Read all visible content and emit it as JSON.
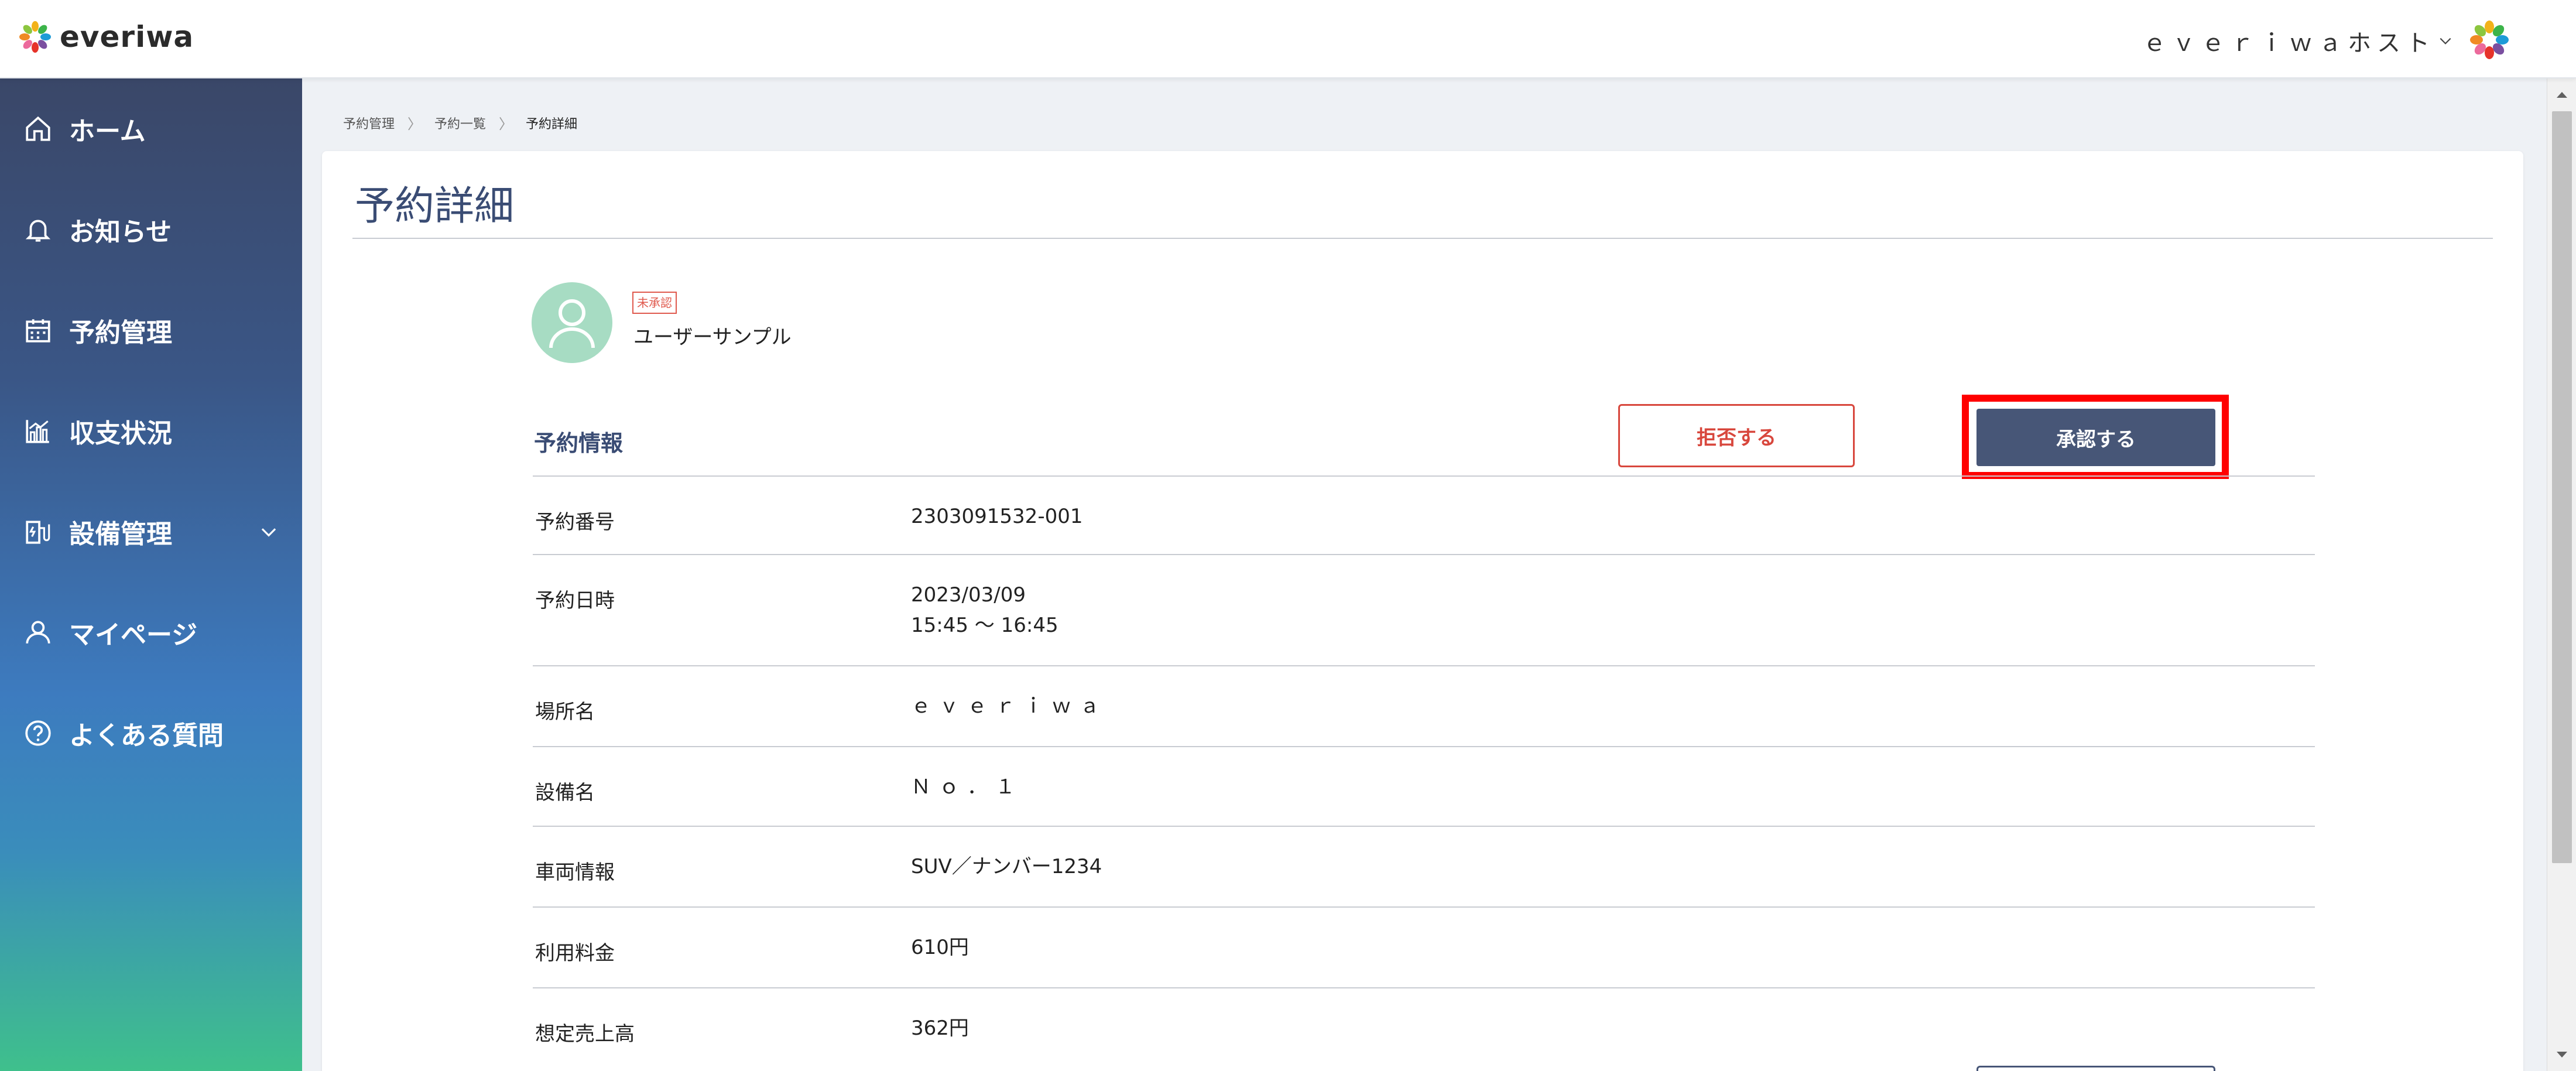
{
  "header": {
    "logo_text": "everiwa",
    "host_label": "ｅｖｅｒｉｗａホスト"
  },
  "sidebar": {
    "items": [
      {
        "label": "ホーム",
        "icon": "home-icon"
      },
      {
        "label": "お知らせ",
        "icon": "bell-icon"
      },
      {
        "label": "予約管理",
        "icon": "calendar-icon"
      },
      {
        "label": "収支状況",
        "icon": "chart-icon"
      },
      {
        "label": "設備管理",
        "icon": "equipment-icon"
      },
      {
        "label": "マイページ",
        "icon": "user-icon"
      },
      {
        "label": "よくある質問",
        "icon": "question-icon"
      }
    ]
  },
  "breadcrumb": {
    "items": [
      "予約管理",
      "予約一覧",
      "予約詳細"
    ]
  },
  "page": {
    "title": "予約詳細"
  },
  "user": {
    "status_badge": "未承認",
    "name": "ユーザーサンプル"
  },
  "section": {
    "title": "予約情報",
    "reject_label": "拒否する",
    "approve_label": "承認する"
  },
  "reservation": {
    "rows": [
      {
        "label": "予約番号",
        "value": "2303091532-001"
      },
      {
        "label": "予約日時",
        "value": "2023/03/09",
        "value2": "15:45 〜 16:45"
      },
      {
        "label": "場所名",
        "value": "ｅｖｅｒｉｗａ"
      },
      {
        "label": "設備名",
        "value": "Ｎｏ．１"
      },
      {
        "label": "車両情報",
        "value": "SUV／ナンバー1234"
      },
      {
        "label": "利用料金",
        "value": "610円"
      },
      {
        "label": "想定売上高",
        "value": "362円"
      }
    ]
  },
  "colors": {
    "accent": "#475677",
    "reject": "#d8473d",
    "highlight": "#ff0000",
    "title": "#3a4c74"
  }
}
